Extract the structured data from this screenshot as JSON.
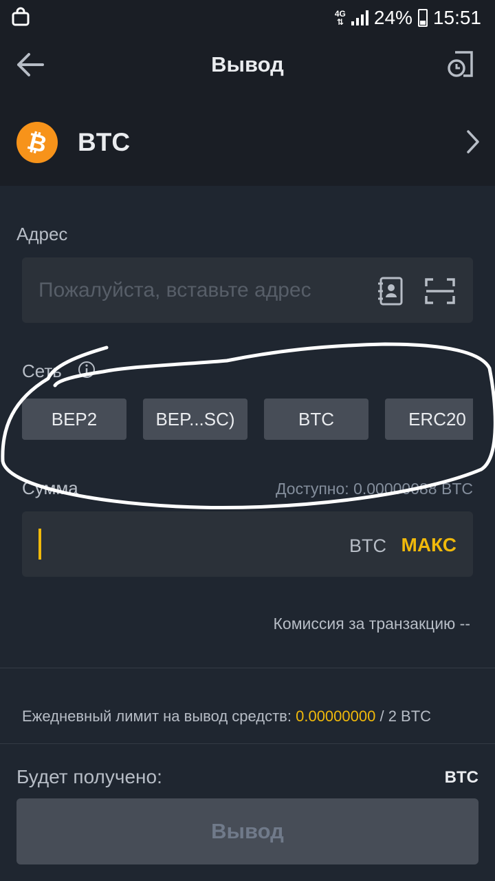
{
  "status_bar": {
    "network": "4G",
    "battery": "24%",
    "time": "15:51"
  },
  "header": {
    "title": "Вывод"
  },
  "coin": {
    "symbol": "BTC",
    "logo_color": "#f7931a"
  },
  "address": {
    "label": "Адрес",
    "placeholder": "Пожалуйста, вставьте адрес"
  },
  "network": {
    "label": "Сеть",
    "options": [
      {
        "label": "BEP2"
      },
      {
        "label": "BEP...SC)"
      },
      {
        "label": "BTC"
      },
      {
        "label": "ERC20"
      }
    ]
  },
  "amount": {
    "label": "Сумма",
    "available": "Доступно: 0.00000088 BTC",
    "unit": "BTC",
    "max_label": "МАКС"
  },
  "fee": {
    "text": "Комиссия за транзакцию --"
  },
  "limit": {
    "prefix": "Ежедневный лимит на вывод средств:",
    "used": "0.00000000",
    "suffix": "/ 2 BTC"
  },
  "receive": {
    "label": "Будет получено:",
    "unit": "BTC"
  },
  "submit": {
    "label": "Вывод"
  },
  "colors": {
    "accent": "#f0b90b",
    "background": "#1f2630",
    "card": "#2b3139",
    "chip": "#474d57"
  }
}
